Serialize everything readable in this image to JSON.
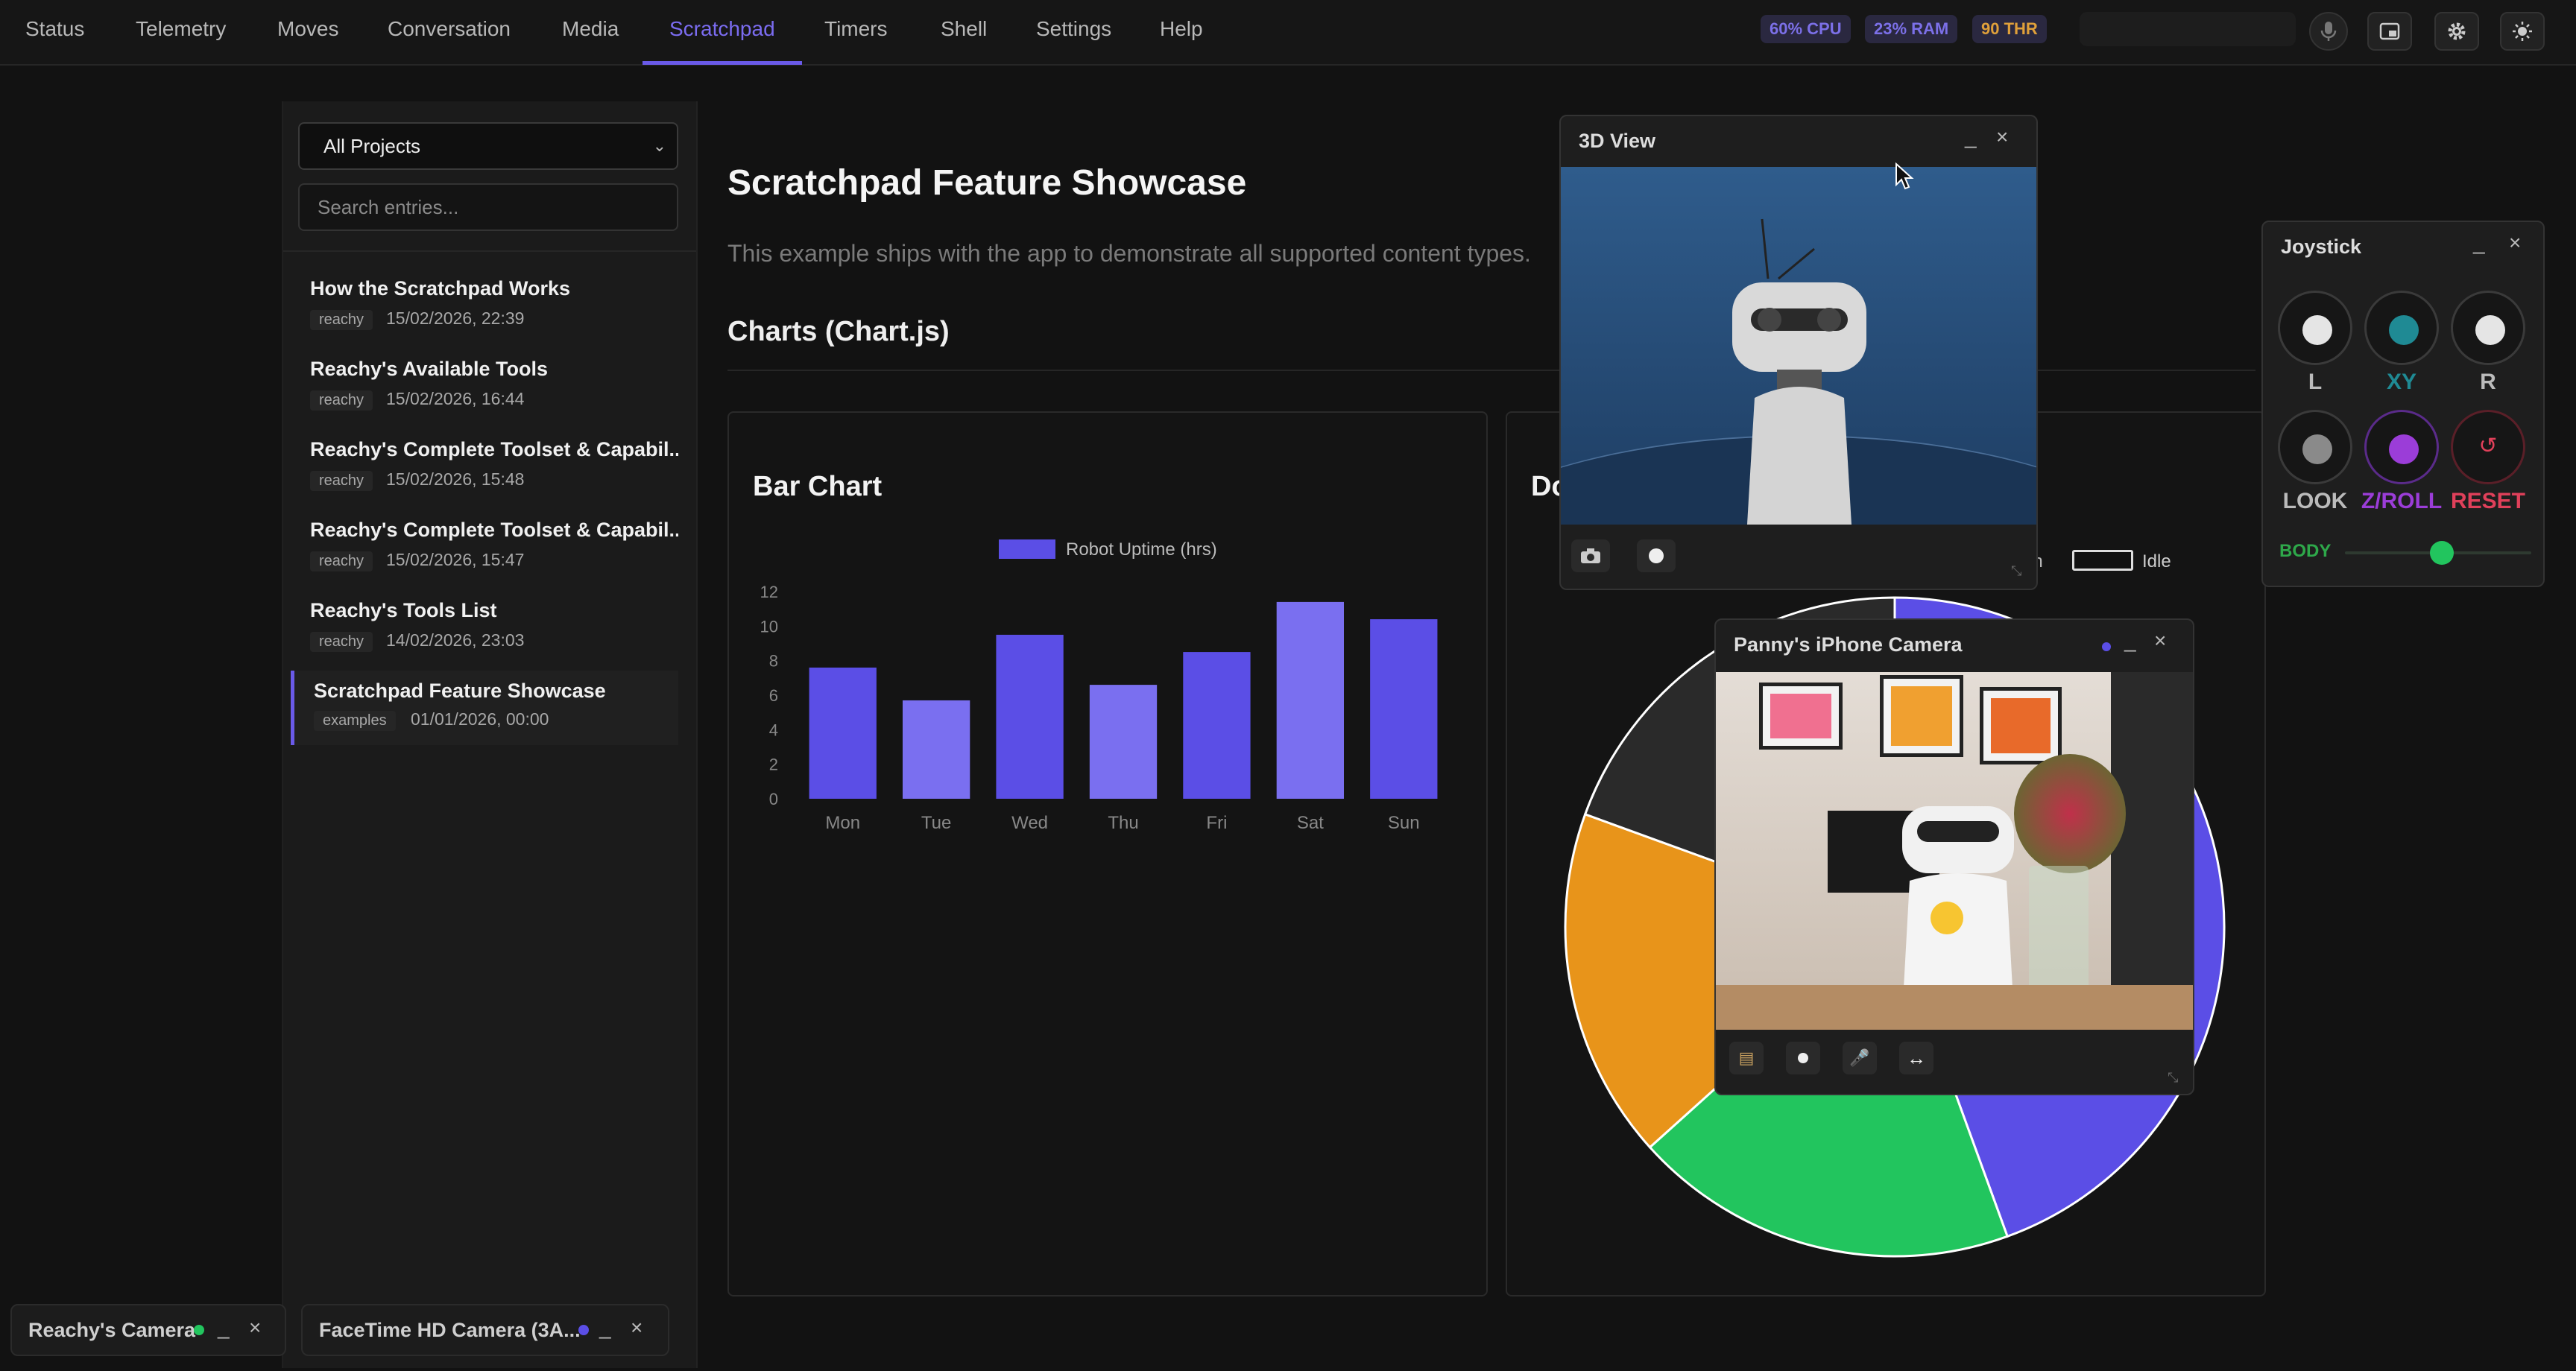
{
  "nav": {
    "tabs": [
      "Status",
      "Telemetry",
      "Moves",
      "Conversation",
      "Media",
      "Scratchpad",
      "Timers",
      "Shell",
      "Settings",
      "Help"
    ],
    "active": "Scratchpad",
    "stats": {
      "cpu": "60% CPU",
      "ram": "23% RAM",
      "thr": "90 THR"
    },
    "icons": [
      "microphone-icon",
      "picture-in-picture-icon",
      "gear-icon",
      "sun-icon"
    ]
  },
  "sidebar": {
    "project_select": "All Projects",
    "search_placeholder": "Search entries...",
    "entries": [
      {
        "title": "How the Scratchpad Works",
        "tag": "reachy",
        "date": "15/02/2026, 22:39"
      },
      {
        "title": "Reachy's Available Tools",
        "tag": "reachy",
        "date": "15/02/2026, 16:44"
      },
      {
        "title": "Reachy's Complete Toolset & Capabil...",
        "tag": "reachy",
        "date": "15/02/2026, 15:48"
      },
      {
        "title": "Reachy's Complete Toolset & Capabil...",
        "tag": "reachy",
        "date": "15/02/2026, 15:47"
      },
      {
        "title": "Reachy's Tools List",
        "tag": "reachy",
        "date": "14/02/2026, 23:03"
      },
      {
        "title": "Scratchpad Feature Showcase",
        "tag": "examples",
        "date": "01/01/2026, 00:00"
      }
    ]
  },
  "main": {
    "title": "Scratchpad Feature Showcase",
    "description": "This example ships with the app to demonstrate all supported content types.",
    "section": "Charts (Chart.js)",
    "bar_card_title": "Bar Chart",
    "doughnut_card_title": "Do",
    "doughnut_legend_visible": [
      "on",
      "Idle"
    ]
  },
  "chart_data": [
    {
      "type": "bar",
      "title": "Bar Chart",
      "categories": [
        "Mon",
        "Tue",
        "Wed",
        "Thu",
        "Fri",
        "Sat",
        "Sun"
      ],
      "series": [
        {
          "name": "Robot Uptime (hrs)",
          "values": [
            7.6,
            5.7,
            9.5,
            6.6,
            8.5,
            11.4,
            10.4
          ]
        }
      ],
      "yticks": [
        "0",
        "2",
        "4",
        "6",
        "8",
        "10",
        "12"
      ],
      "ylim": [
        0,
        12
      ],
      "colors": [
        "#5b4ee6",
        "#7a6ff0"
      ]
    },
    {
      "type": "pie",
      "title": "Do",
      "partial": true,
      "legend": [
        "on",
        "Idle"
      ],
      "colors": [
        "#5b4ee6",
        "#22c55e",
        "#e8941a",
        "#2a2a2a"
      ]
    }
  ],
  "windows": {
    "view3d": {
      "title": "3D View",
      "minimize": "_",
      "close": "×"
    },
    "iphone": {
      "title": "Panny's iPhone Camera",
      "minimize": "_",
      "close": "×"
    },
    "joystick": {
      "title": "Joystick",
      "minimize": "_",
      "close": "×",
      "labels": [
        "L",
        "XY",
        "R",
        "LOOK",
        "Z/ROLL",
        "RESET"
      ],
      "body_label": "BODY",
      "body_value": 0.52
    }
  },
  "dock": [
    {
      "label": "Reachy's Camera",
      "minimize": "_",
      "close": "×"
    },
    {
      "label": "FaceTime HD Camera (3A...",
      "minimize": "_",
      "close": "×"
    }
  ]
}
